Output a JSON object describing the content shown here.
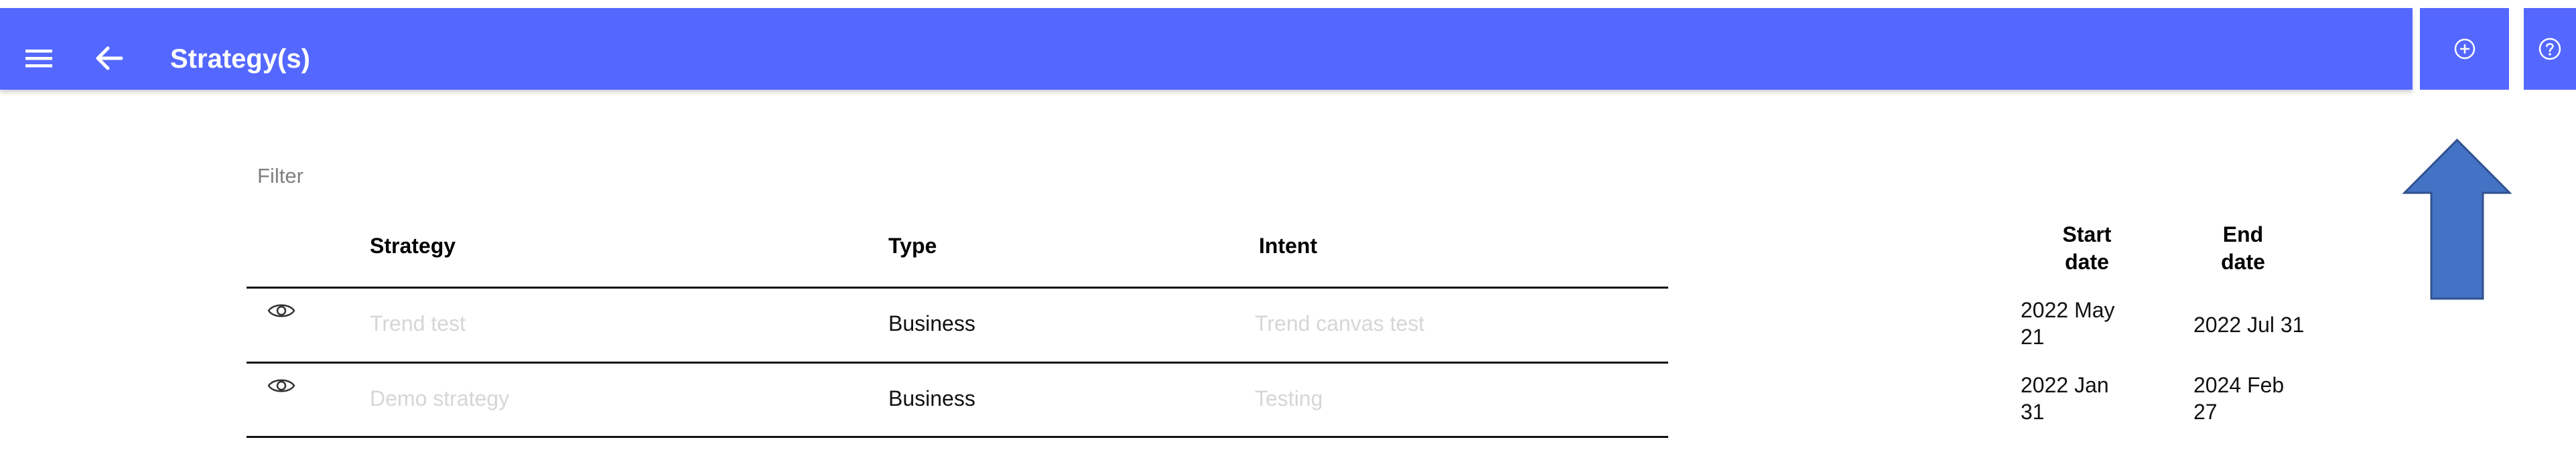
{
  "header": {
    "title": "Strategy(s)",
    "accent_color": "#5468ff",
    "menu_icon": "menu-icon",
    "back_icon": "arrow-left-icon",
    "add_icon": "add-circle-icon",
    "help_icon": "help-circle-icon"
  },
  "filter": {
    "placeholder": "Filter",
    "value": ""
  },
  "table": {
    "columns": {
      "strategy": "Strategy",
      "type": "Type",
      "intent": "Intent",
      "start_date": [
        "Start",
        "date"
      ],
      "end_date": [
        "End",
        "date"
      ]
    },
    "rows": [
      {
        "view_icon": "eye-icon",
        "strategy": "Trend test",
        "type": "Business",
        "intent": "Trend canvas test",
        "start_date": [
          "2022 May",
          "21"
        ],
        "end_date": [
          "2022 Jul 31"
        ]
      },
      {
        "view_icon": "eye-icon",
        "strategy": "Demo strategy",
        "type": "Business",
        "intent": "Testing",
        "start_date": [
          "2022 Jan",
          "31"
        ],
        "end_date": [
          "2024 Feb",
          "27"
        ]
      }
    ]
  },
  "annotation": {
    "arrow_color": "#4472c4",
    "arrow_icon": "up-arrow-annotation"
  }
}
